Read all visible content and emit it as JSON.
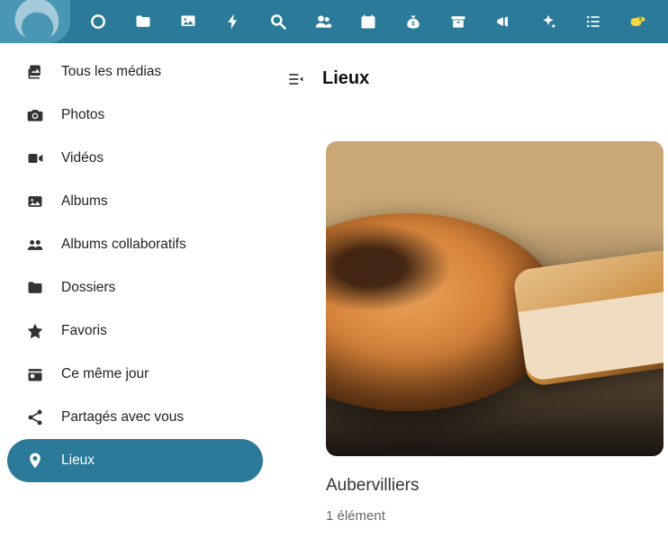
{
  "page": {
    "title": "Lieux"
  },
  "sidebar": {
    "items": [
      {
        "label": "Tous les médias",
        "icon": "image-stack",
        "selected": false
      },
      {
        "label": "Photos",
        "icon": "camera",
        "selected": false
      },
      {
        "label": "Vidéos",
        "icon": "video",
        "selected": false
      },
      {
        "label": "Albums",
        "icon": "image-frame",
        "selected": false
      },
      {
        "label": "Albums collaboratifs",
        "icon": "group",
        "selected": false
      },
      {
        "label": "Dossiers",
        "icon": "folder",
        "selected": false
      },
      {
        "label": "Favoris",
        "icon": "star",
        "selected": false
      },
      {
        "label": "Ce même jour",
        "icon": "calendar-today",
        "selected": false
      },
      {
        "label": "Partagés avec vous",
        "icon": "share",
        "selected": false
      },
      {
        "label": "Lieux",
        "icon": "location",
        "selected": true
      }
    ]
  },
  "topbar": {
    "icons": [
      "circle",
      "folder",
      "image",
      "bolt",
      "search",
      "users",
      "calendar",
      "money-bag",
      "archive",
      "megaphone",
      "sparkle",
      "list",
      "coins"
    ],
    "active_index": 2
  },
  "places": [
    {
      "name": "Aubervilliers",
      "count_label": "1 élément"
    }
  ]
}
